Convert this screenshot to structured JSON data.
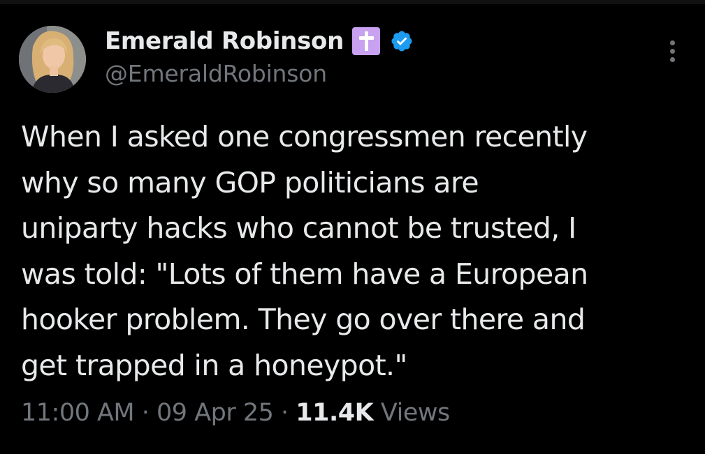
{
  "author": {
    "display_name": "Emerald Robinson",
    "handle": "@EmeraldRobinson",
    "badge_icon": "cross-icon",
    "verified_icon": "verified-check-icon",
    "badge_color": "#c8a2f0",
    "verified_color": "#1d9bf0"
  },
  "tweet": {
    "lines": [
      "When I asked one congressmen recently",
      "why so many GOP politicians are",
      "uniparty hacks who cannot be trusted, I",
      "was told: \"Lots of them have a European",
      "hooker problem. They go over there and",
      "get trapped in a honeypot.\""
    ]
  },
  "meta": {
    "time": "11:00 AM",
    "separator": " · ",
    "date": "09 Apr 25",
    "views_count": "11.4K",
    "views_label": "Views"
  },
  "menu": {
    "icon": "more-vertical-icon"
  }
}
